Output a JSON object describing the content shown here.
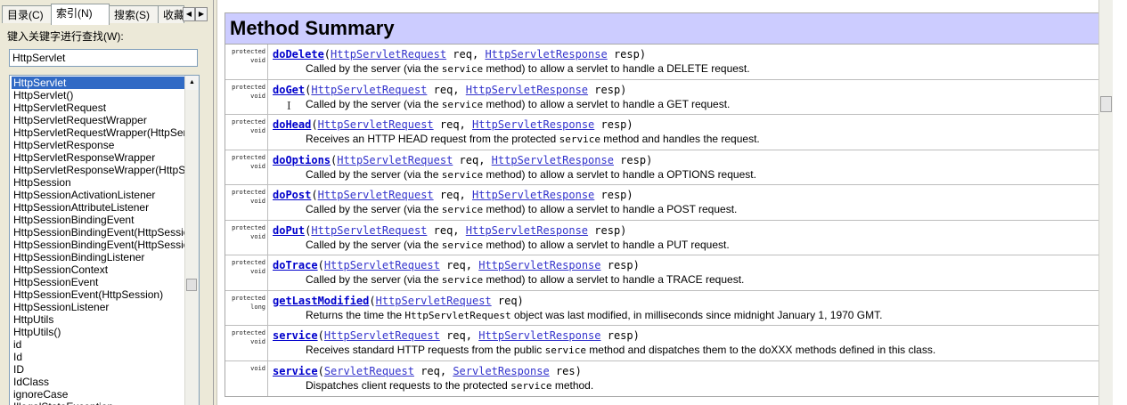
{
  "nav": {
    "tabs": [
      {
        "label": "目录(C)"
      },
      {
        "label": "索引(N)"
      },
      {
        "label": "搜索(S)"
      },
      {
        "label": "收藏"
      }
    ],
    "keyword_label": "键入关键字进行查找(W):",
    "keyword_value": "HttpServlet",
    "index_items": [
      "HttpServlet",
      "HttpServlet()",
      "HttpServletRequest",
      "HttpServletRequestWrapper",
      "HttpServletRequestWrapper(HttpServl",
      "HttpServletResponse",
      "HttpServletResponseWrapper",
      "HttpServletResponseWrapper(HttpSe",
      "HttpSession",
      "HttpSessionActivationListener",
      "HttpSessionAttributeListener",
      "HttpSessionBindingEvent",
      "HttpSessionBindingEvent(HttpSessio",
      "HttpSessionBindingEvent(HttpSessio",
      "HttpSessionBindingListener",
      "HttpSessionContext",
      "HttpSessionEvent",
      "HttpSessionEvent(HttpSession)",
      "HttpSessionListener",
      "HttpUtils",
      "HttpUtils()",
      "id",
      "Id",
      "ID",
      "IdClass",
      "ignoreCase",
      "IllegalStateException"
    ]
  },
  "summary": {
    "title": "Method Summary",
    "methods": [
      {
        "mod1": "protected",
        "mod2": "void",
        "name": "doDelete",
        "p1type": "HttpServletRequest",
        "p1name": " req,",
        "p2type": "HttpServletResponse",
        "p2name": " resp)",
        "desc_a": "Called by the server (via the ",
        "desc_code": "service",
        "desc_b": " method) to allow a servlet to handle a DELETE request."
      },
      {
        "mod1": "protected",
        "mod2": "void",
        "name": "doGet",
        "p1type": "HttpServletRequest",
        "p1name": " req,",
        "p2type": "HttpServletResponse",
        "p2name": " resp)",
        "desc_a": "Called by the server (via the ",
        "desc_code": "service",
        "desc_b": " method) to allow a servlet to handle a GET request."
      },
      {
        "mod1": "protected",
        "mod2": "void",
        "name": "doHead",
        "p1type": "HttpServletRequest",
        "p1name": " req,",
        "p2type": "HttpServletResponse",
        "p2name": " resp)",
        "desc_a": "Receives an HTTP HEAD request from the protected ",
        "desc_code": "service",
        "desc_b": " method and handles the request."
      },
      {
        "mod1": "protected",
        "mod2": "void",
        "name": "doOptions",
        "p1type": "HttpServletRequest",
        "p1name": " req,",
        "p2type": "HttpServletResponse",
        "p2name": " resp)",
        "desc_a": "Called by the server (via the ",
        "desc_code": "service",
        "desc_b": " method) to allow a servlet to handle a OPTIONS request."
      },
      {
        "mod1": "protected",
        "mod2": "void",
        "name": "doPost",
        "p1type": "HttpServletRequest",
        "p1name": " req,",
        "p2type": "HttpServletResponse",
        "p2name": " resp)",
        "desc_a": "Called by the server (via the ",
        "desc_code": "service",
        "desc_b": " method) to allow a servlet to handle a POST request."
      },
      {
        "mod1": "protected",
        "mod2": "void",
        "name": "doPut",
        "p1type": "HttpServletRequest",
        "p1name": " req,",
        "p2type": "HttpServletResponse",
        "p2name": " resp)",
        "desc_a": "Called by the server (via the ",
        "desc_code": "service",
        "desc_b": " method) to allow a servlet to handle a PUT request."
      },
      {
        "mod1": "protected",
        "mod2": "void",
        "name": "doTrace",
        "p1type": "HttpServletRequest",
        "p1name": " req,",
        "p2type": "HttpServletResponse",
        "p2name": " resp)",
        "desc_a": "Called by the server (via the ",
        "desc_code": "service",
        "desc_b": " method) to allow a servlet to handle a TRACE request."
      },
      {
        "mod1": "protected",
        "mod2": "long",
        "name": "getLastModified",
        "p1type": "HttpServletRequest",
        "p1name": " req)",
        "p2type": "",
        "p2name": "",
        "desc_a": "Returns the time the ",
        "desc_code": "HttpServletRequest",
        "desc_b": " object was last modified, in milliseconds since midnight January 1, 1970 GMT."
      },
      {
        "mod1": "protected",
        "mod2": "void",
        "name": "service",
        "p1type": "HttpServletRequest",
        "p1name": " req,",
        "p2type": "HttpServletResponse",
        "p2name": " resp)",
        "desc_a": "Receives standard HTTP requests from the public ",
        "desc_code": "service",
        "desc_b": " method and dispatches them to the doXXX methods defined in this class."
      },
      {
        "mod1": "",
        "mod2": "void",
        "name": "service",
        "p1type": "ServletRequest",
        "p1name": " req,",
        "p2type": "ServletResponse",
        "p2name": " res)",
        "desc_a": "Dispatches client requests to the protected ",
        "desc_code": "service",
        "desc_b": " method."
      }
    ]
  }
}
